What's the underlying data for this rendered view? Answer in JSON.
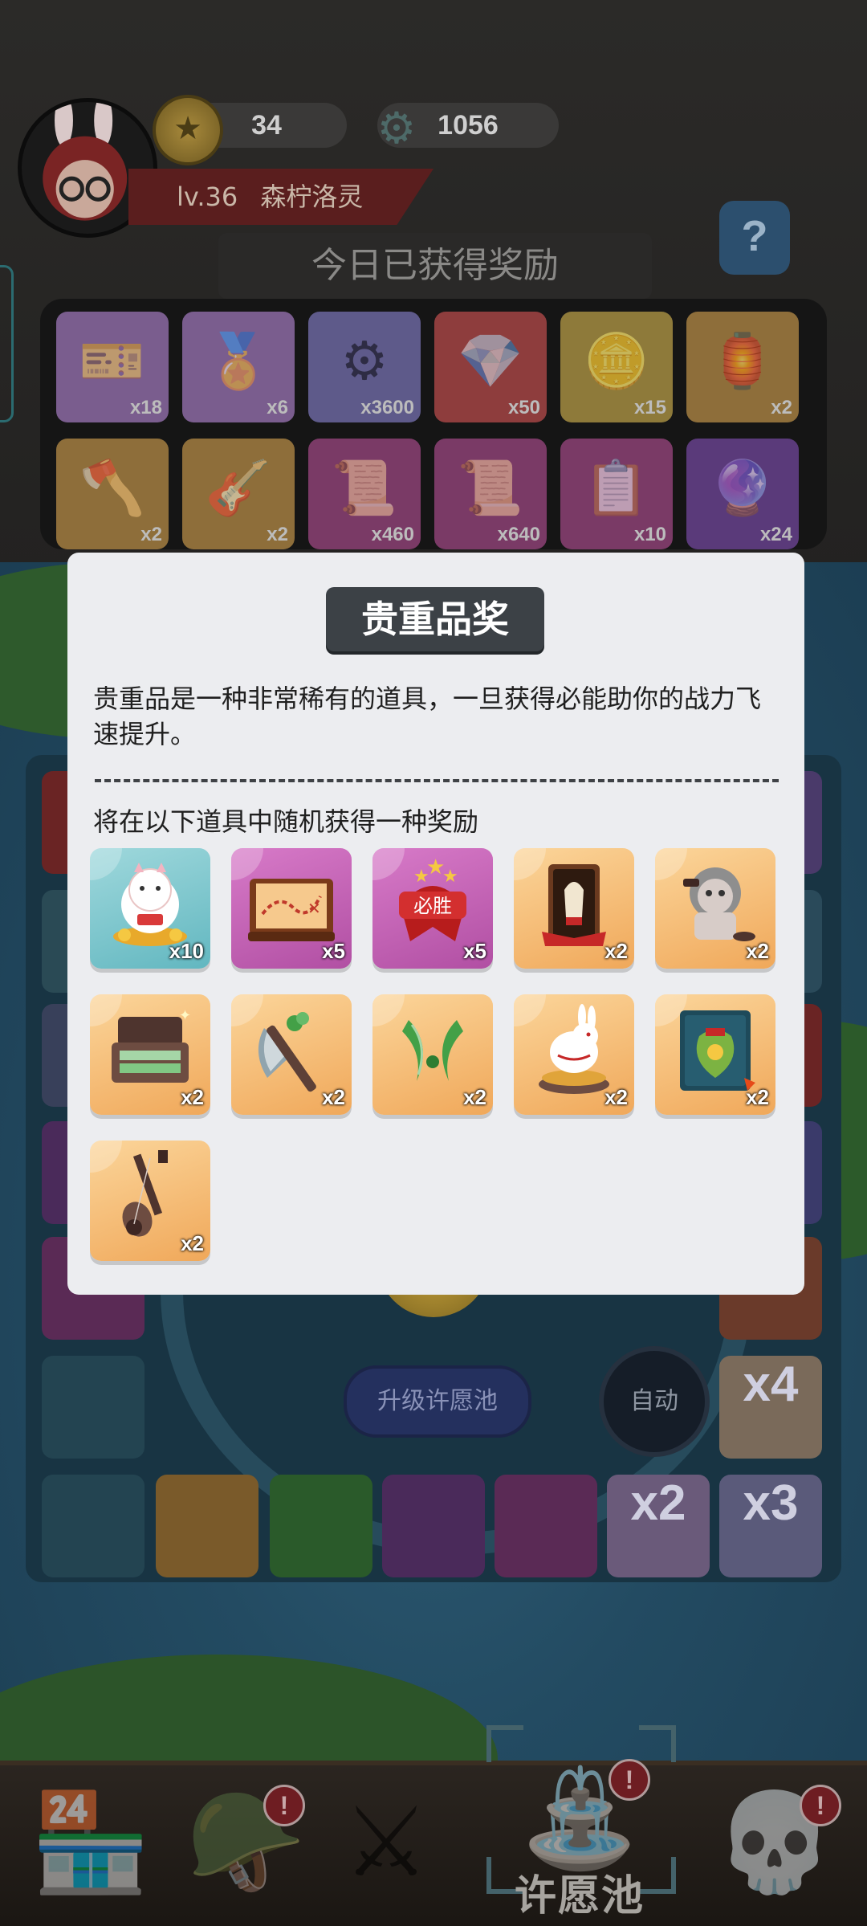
{
  "header": {
    "coins": "34",
    "gears": "1056",
    "level": "lv.36",
    "player_name": "森柠洛灵",
    "help": "?"
  },
  "today_rewards": {
    "title": "今日已获得奖励",
    "items": [
      {
        "icon": "document-ticket-icon",
        "qty": "x18",
        "color": "#7a5d8e"
      },
      {
        "icon": "medal-icon",
        "qty": "x6",
        "color": "#7a5d8e"
      },
      {
        "icon": "gear-icon",
        "qty": "x3600",
        "color": "#5e5a8a"
      },
      {
        "icon": "crystal-icon",
        "qty": "x50",
        "color": "#8e3d3d"
      },
      {
        "icon": "coin-icon",
        "qty": "x15",
        "color": "#8e7a3a"
      },
      {
        "icon": "lantern-card-icon",
        "qty": "x2",
        "color": "#8e6e3a"
      },
      {
        "icon": "axe-icon",
        "qty": "x2",
        "color": "#8e6e3a"
      },
      {
        "icon": "guitar-icon",
        "qty": "x2",
        "color": "#8e6e3a"
      },
      {
        "icon": "scroll-icon",
        "qty": "x460",
        "color": "#7a3a66"
      },
      {
        "icon": "scroll-icon",
        "qty": "x640",
        "color": "#7a3a66"
      },
      {
        "icon": "poster-icon",
        "qty": "x10",
        "color": "#7a3a66"
      },
      {
        "icon": "orb-icon",
        "qty": "x24",
        "color": "#5a3a7a"
      }
    ]
  },
  "board": {
    "wish_button": "许愿",
    "upgrade_button": "升级许愿池",
    "auto_button": "自动",
    "multipliers": [
      "x4",
      "x2",
      "x3"
    ]
  },
  "bottom_nav": {
    "active_label": "许愿池",
    "badge": "!"
  },
  "modal": {
    "title": "贵重品奖",
    "description": "贵重品是一种非常稀有的道具，一旦获得必能助你的战力飞速提升。",
    "subtitle": "将在以下道具中随机获得一种奖励",
    "items": [
      {
        "name": "lucky-cat-icon",
        "qty": "x10",
        "bg": "teal"
      },
      {
        "name": "treasure-map-icon",
        "qty": "x5",
        "bg": "purple"
      },
      {
        "name": "victory-ribbon-icon",
        "qty": "x5",
        "bg": "purple"
      },
      {
        "name": "lantern-card-icon",
        "qty": "x2",
        "bg": "orange"
      },
      {
        "name": "lion-statue-icon",
        "qty": "x2",
        "bg": "orange"
      },
      {
        "name": "cash-box-icon",
        "qty": "x2",
        "bg": "orange"
      },
      {
        "name": "axe-icon",
        "qty": "x2",
        "bg": "orange"
      },
      {
        "name": "twin-blades-icon",
        "qty": "x2",
        "bg": "orange"
      },
      {
        "name": "rabbit-figurine-icon",
        "qty": "x2",
        "bg": "orange"
      },
      {
        "name": "lucky-bag-card-icon",
        "qty": "x2",
        "bg": "orange"
      },
      {
        "name": "guitar-icon",
        "qty": "x2",
        "bg": "orange"
      }
    ]
  }
}
